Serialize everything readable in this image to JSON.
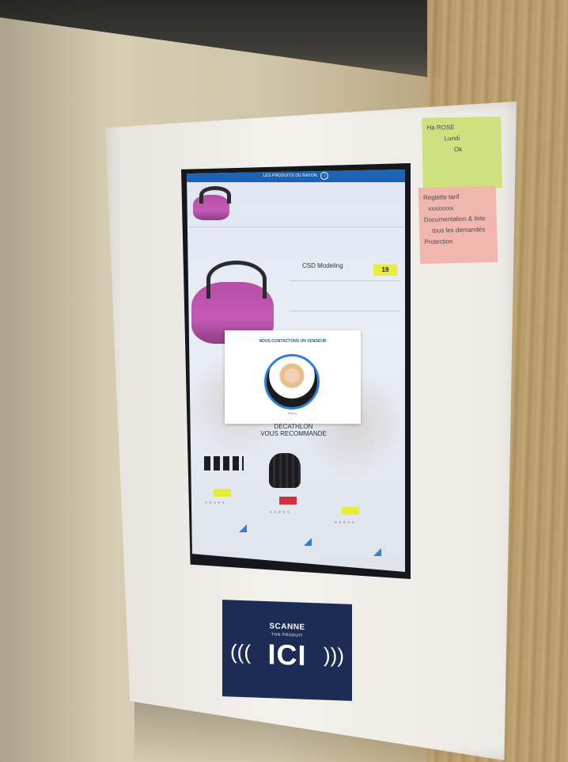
{
  "kiosk": {
    "header": "LES PRODUITS DU RAYON",
    "product_title": "CSD Modeling",
    "price": "19",
    "popup": {
      "title": "NOUS CONTACTONS UN VENDEUR",
      "caption": "Ines a."
    },
    "recommend_title": [
      "DECATHLON",
      "VOUS RECOMMANDE"
    ]
  },
  "sticky_notes": {
    "green": [
      "Ha ROSE",
      "Lundi",
      "Ok"
    ],
    "pink": [
      "Reglette tarif",
      "xxxxxxxx",
      "Documentation & liste",
      "tous les demandés",
      "Protection"
    ]
  },
  "scan_panel": {
    "line1": "SCANNE",
    "line2": "TON PRODUIT",
    "line3": "ICI",
    "icon_left": "nfc-wave-left",
    "icon_right": "nfc-wave-right"
  },
  "colors": {
    "screen_header": "#1d63b3",
    "price_tag": "#e7ee3a",
    "scan_panel": "#1c2c55",
    "note_green": "#cfe07e",
    "note_pink": "#f1b6ad"
  }
}
